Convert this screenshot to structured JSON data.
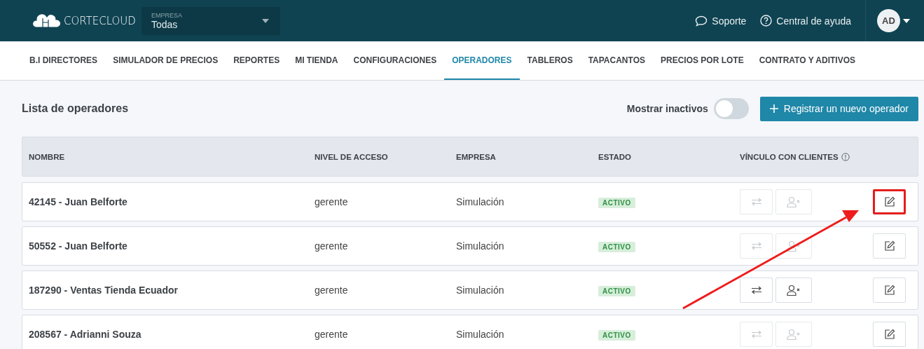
{
  "header": {
    "logo": "CORTECLOUD",
    "company_select": {
      "label": "EMPRESA",
      "value": "Todas"
    },
    "links": [
      "Soporte",
      "Central de ayuda"
    ],
    "avatar": "AD"
  },
  "nav": [
    {
      "label": "B.I DIRECTORES",
      "selected": false
    },
    {
      "label": "SIMULADOR DE PRECIOS",
      "selected": false
    },
    {
      "label": "REPORTES",
      "selected": false
    },
    {
      "label": "MI TIENDA",
      "selected": false
    },
    {
      "label": "CONFIGURACIONES",
      "selected": false
    },
    {
      "label": "OPERADORES",
      "selected": true
    },
    {
      "label": "TABLEROS",
      "selected": false
    },
    {
      "label": "TAPACANTOS",
      "selected": false
    },
    {
      "label": "PRECIOS POR LOTE",
      "selected": false
    },
    {
      "label": "CONTRATO Y ADITIVOS",
      "selected": false
    }
  ],
  "page": {
    "title": "Lista de operadores",
    "toggle": {
      "label": "Mostrar inactivos",
      "on": false
    },
    "new_button": "Registrar un nuevo operador"
  },
  "table": {
    "columns": [
      "NOMBRE",
      "NIVEL DE ACCESO",
      "EMPRESA",
      "ESTADO",
      "VÍNCULO CON CLIENTES"
    ],
    "rows": [
      {
        "name": "42145 - Juan Belforte",
        "level": "gerente",
        "company": "Simulación",
        "status": "ACTIVO",
        "link_enabled": false,
        "highlighted": true
      },
      {
        "name": "50552 - Juan Belforte",
        "level": "gerente",
        "company": "Simulación",
        "status": "ACTIVO",
        "link_enabled": false,
        "highlighted": false
      },
      {
        "name": "187290 - Ventas Tienda Ecuador",
        "level": "gerente",
        "company": "Simulación",
        "status": "ACTIVO",
        "link_enabled": true,
        "highlighted": false
      },
      {
        "name": "208567 - Adrianni Souza",
        "level": "gerente",
        "company": "Simulación",
        "status": "ACTIVO",
        "link_enabled": false,
        "highlighted": false
      }
    ]
  }
}
